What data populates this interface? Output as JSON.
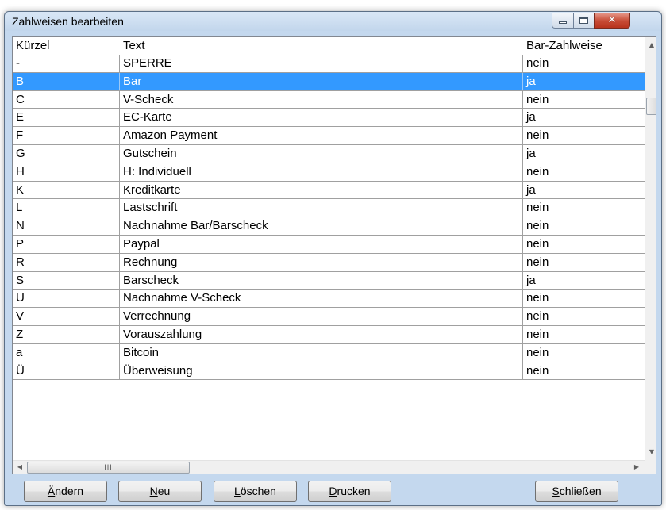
{
  "window": {
    "title": "Zahlweisen bearbeiten",
    "close_glyph": "✕"
  },
  "table": {
    "columns": [
      "Kürzel",
      "Text",
      "Bar-Zahlweise"
    ],
    "selected_index": 1,
    "rows": [
      {
        "kuerzel": "-",
        "text": "SPERRE",
        "bar": "nein"
      },
      {
        "kuerzel": "B",
        "text": "Bar",
        "bar": "ja"
      },
      {
        "kuerzel": "C",
        "text": "V-Scheck",
        "bar": "nein"
      },
      {
        "kuerzel": "E",
        "text": "EC-Karte",
        "bar": "ja"
      },
      {
        "kuerzel": "F",
        "text": "Amazon Payment",
        "bar": "nein"
      },
      {
        "kuerzel": "G",
        "text": "Gutschein",
        "bar": "ja"
      },
      {
        "kuerzel": "H",
        "text": "H: Individuell",
        "bar": "nein"
      },
      {
        "kuerzel": "K",
        "text": "Kreditkarte",
        "bar": "ja"
      },
      {
        "kuerzel": "L",
        "text": "Lastschrift",
        "bar": "nein"
      },
      {
        "kuerzel": "N",
        "text": "Nachnahme Bar/Barscheck",
        "bar": "nein"
      },
      {
        "kuerzel": "P",
        "text": "Paypal",
        "bar": "nein"
      },
      {
        "kuerzel": "R",
        "text": "Rechnung",
        "bar": "nein"
      },
      {
        "kuerzel": "S",
        "text": "Barscheck",
        "bar": "ja"
      },
      {
        "kuerzel": "U",
        "text": "Nachnahme V-Scheck",
        "bar": "nein"
      },
      {
        "kuerzel": "V",
        "text": "Verrechnung",
        "bar": "nein"
      },
      {
        "kuerzel": "Z",
        "text": "Vorauszahlung",
        "bar": "nein"
      },
      {
        "kuerzel": "a",
        "text": "Bitcoin",
        "bar": "nein"
      },
      {
        "kuerzel": "Ü",
        "text": "Überweisung",
        "bar": "nein"
      }
    ]
  },
  "scrollbars": {
    "hthumb_grip": "III",
    "up_arrow": "▲",
    "down_arrow": "▼",
    "left_arrow": "◀",
    "right_arrow": "▶"
  },
  "buttons": {
    "aendern": {
      "accel": "Ä",
      "rest": "ndern"
    },
    "neu": {
      "accel": "N",
      "rest": "eu"
    },
    "loeschen": {
      "accel": "L",
      "rest": "öschen"
    },
    "drucken": {
      "accel": "D",
      "rest": "rucken"
    },
    "schliessen": {
      "accel": "S",
      "rest": "chließen"
    }
  },
  "colors": {
    "selection": "#3399ff",
    "window_frame": "#c4d8ee",
    "close_button": "#c74b35"
  }
}
